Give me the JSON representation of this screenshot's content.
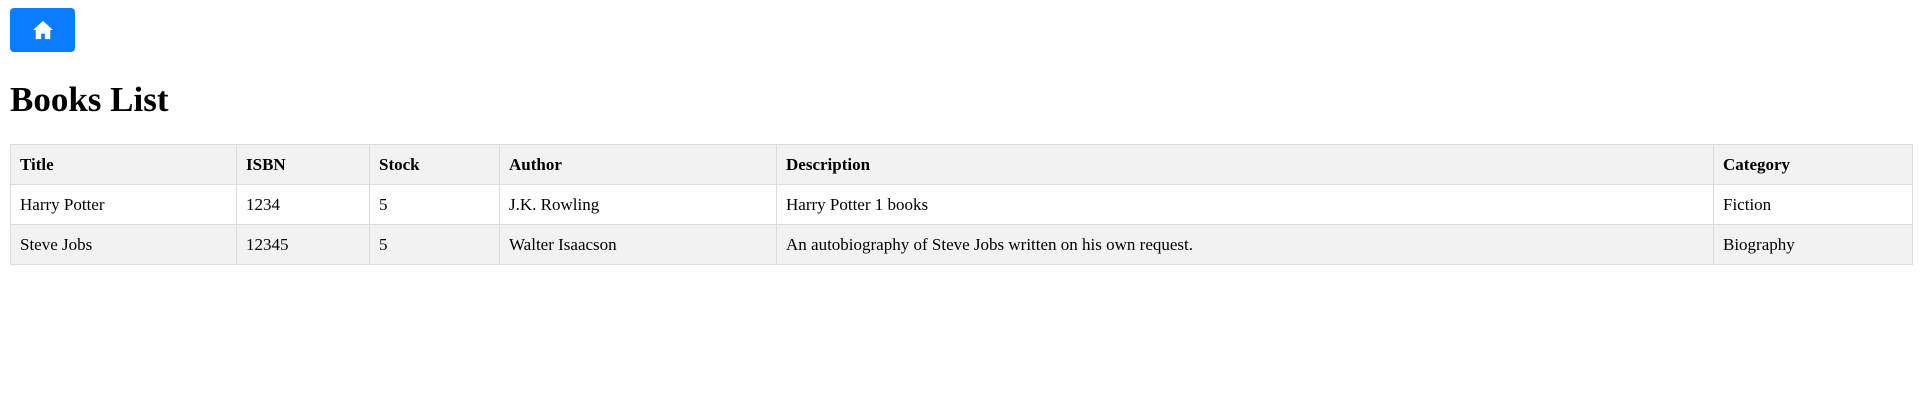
{
  "nav": {
    "home_icon": "home-icon",
    "accent_color": "#0a7cff"
  },
  "page": {
    "title": "Books List"
  },
  "table": {
    "headers": [
      "Title",
      "ISBN",
      "Stock",
      "Author",
      "Description",
      "Category"
    ],
    "rows": [
      [
        "Harry Potter",
        "1234",
        "5",
        "J.K. Rowling",
        "Harry Potter 1 books",
        "Fiction"
      ],
      [
        "Steve Jobs",
        "12345",
        "5",
        "Walter Isaacson",
        "An autobiography of Steve Jobs written on his own request.",
        "Biography"
      ]
    ]
  }
}
